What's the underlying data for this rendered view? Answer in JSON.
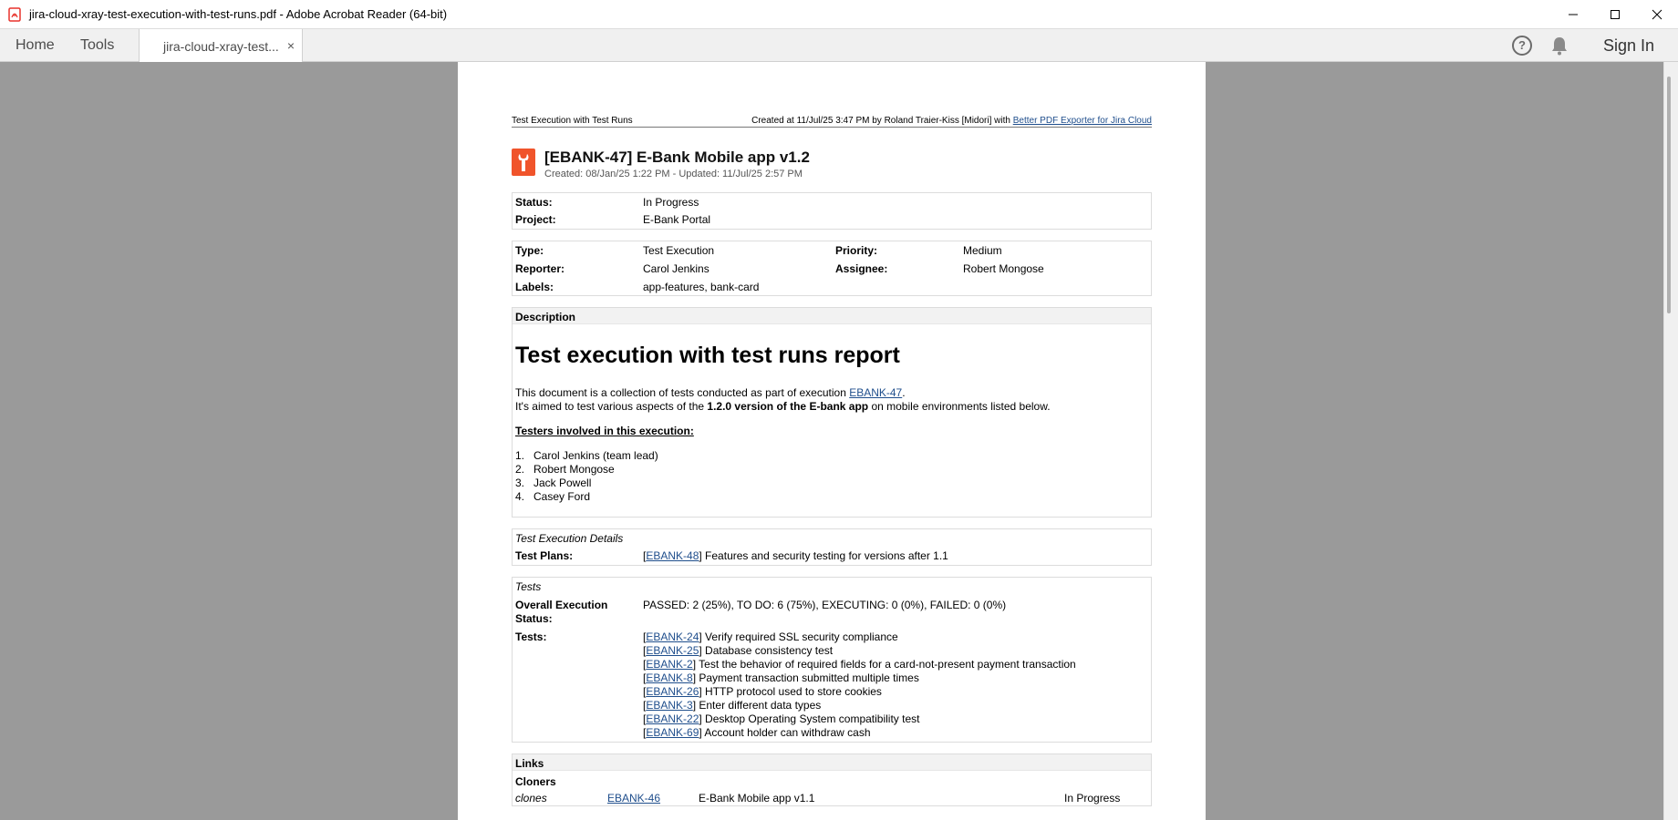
{
  "window": {
    "title": "jira-cloud-xray-test-execution-with-test-runs.pdf - Adobe Acrobat Reader (64-bit)"
  },
  "tabs": {
    "home": "Home",
    "tools": "Tools",
    "document": "jira-cloud-xray-test...",
    "close": "×",
    "help": "?",
    "sign_in": "Sign In"
  },
  "doc": {
    "header_left": "Test Execution with Test Runs",
    "header_right_prefix": "Created at 11/Jul/25 3:47 PM by Roland Traier-Kiss [Midori] with ",
    "header_right_link": "Better PDF Exporter for Jira Cloud",
    "issue_title": "[EBANK-47] E-Bank Mobile app v1.2",
    "issue_sub": "Created: 08/Jan/25 1:22 PM - Updated: 11/Jul/25 2:57 PM",
    "status_label": "Status:",
    "status_value": "In Progress",
    "project_label": "Project:",
    "project_value": "E-Bank Portal",
    "type_label": "Type:",
    "type_value": "Test Execution",
    "priority_label": "Priority:",
    "priority_value": "Medium",
    "reporter_label": "Reporter:",
    "reporter_value": "Carol Jenkins",
    "assignee_label": "Assignee:",
    "assignee_value": "Robert Mongose",
    "labels_label": "Labels:",
    "labels_value": "app-features, bank-card",
    "description_head": "Description",
    "description_title": "Test execution with test runs report",
    "desc_line1_prefix": "This document is a collection of tests conducted as part of execution ",
    "desc_line1_link": "EBANK-47",
    "desc_line1_suffix": ".",
    "desc_line2_prefix": "It's aimed to test various aspects of the ",
    "desc_line2_bold": "1.2.0 version of the E-bank app",
    "desc_line2_suffix": " on mobile environments listed below.",
    "testers_head": "Testers involved in this execution:",
    "testers": [
      {
        "n": "1.",
        "name": "Carol Jenkins (team lead)"
      },
      {
        "n": "2.",
        "name": "Robert Mongose"
      },
      {
        "n": "3.",
        "name": "Jack Powell"
      },
      {
        "n": "4.",
        "name": "Casey Ford"
      }
    ],
    "ted_head": "Test Execution Details",
    "test_plans_label": "Test Plans:",
    "test_plans_link": "EBANK-48",
    "test_plans_text": " Features and security testing for versions after 1.1",
    "tests_head": "Tests",
    "overall_label_1": "Overall Execution",
    "overall_label_2": "Status:",
    "overall_value": "PASSED: 2 (25%), TO DO: 6 (75%), EXECUTING: 0 (0%), FAILED: 0 (0%)",
    "tests_label": "Tests:",
    "tests": [
      {
        "key": "EBANK-24",
        "text": " Verify required SSL security compliance"
      },
      {
        "key": "EBANK-25",
        "text": " Database consistency test"
      },
      {
        "key": "EBANK-2",
        "text": " Test the behavior of required fields for a card-not-present payment transaction"
      },
      {
        "key": "EBANK-8",
        "text": " Payment transaction submitted multiple times"
      },
      {
        "key": "EBANK-26",
        "text": " HTTP protocol used to store cookies"
      },
      {
        "key": "EBANK-3",
        "text": " Enter different data types"
      },
      {
        "key": "EBANK-22",
        "text": " Desktop Operating System compatibility test"
      },
      {
        "key": "EBANK-69",
        "text": " Account holder can withdraw cash"
      }
    ],
    "links_head": "Links",
    "cloners_head": "Cloners",
    "clone_rel": "clones",
    "clone_key": "EBANK-46",
    "clone_summary": "E-Bank Mobile app v1.1",
    "clone_status": "In Progress"
  },
  "colors": {
    "pdf_red": "#e8322b",
    "issue_icon": "#f0542b",
    "link": "#1f4e8c",
    "workspace": "#9a9a9a"
  }
}
